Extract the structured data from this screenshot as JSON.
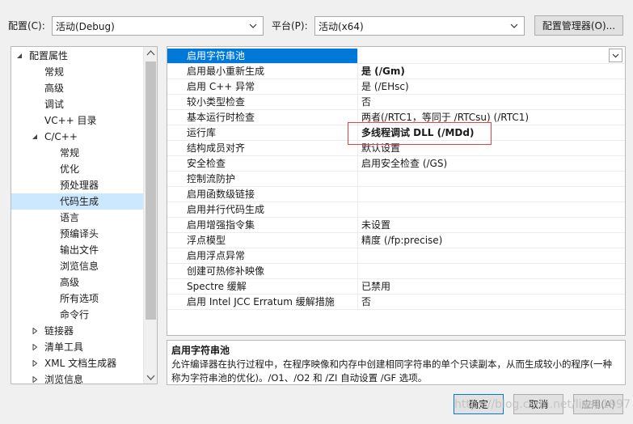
{
  "top_bar": {
    "config_label": "配置(C):",
    "config_value": "活动(Debug)",
    "platform_label": "平台(P):",
    "platform_value": "活动(x64)",
    "config_manager_button": "配置管理器(O)..."
  },
  "tree": {
    "items": [
      {
        "label": "配置属性",
        "expanded": true
      },
      {
        "label": "常规"
      },
      {
        "label": "高级"
      },
      {
        "label": "调试"
      },
      {
        "label": "VC++ 目录"
      },
      {
        "label": "C/C++",
        "expanded": true
      },
      {
        "label": "常规"
      },
      {
        "label": "优化"
      },
      {
        "label": "预处理器"
      },
      {
        "label": "代码生成",
        "selected": true
      },
      {
        "label": "语言"
      },
      {
        "label": "预编译头"
      },
      {
        "label": "输出文件"
      },
      {
        "label": "浏览信息"
      },
      {
        "label": "高级"
      },
      {
        "label": "所有选项"
      },
      {
        "label": "命令行"
      },
      {
        "label": "链接器",
        "expanded": false
      },
      {
        "label": "清单工具",
        "expanded": false
      },
      {
        "label": "XML 文档生成器",
        "expanded": false
      },
      {
        "label": "浏览信息",
        "expanded": false
      }
    ]
  },
  "properties": [
    {
      "name": "启用字符串池",
      "value": "",
      "selected": true
    },
    {
      "name": "启用最小重新生成",
      "value": "是 (/Gm)",
      "bold": true
    },
    {
      "name": "启用 C++ 异常",
      "value": "是 (/EHsc)"
    },
    {
      "name": "较小类型检查",
      "value": "否"
    },
    {
      "name": "基本运行时检查",
      "value": "两者(/RTC1，等同于 /RTCsu) (/RTC1)"
    },
    {
      "name": "运行库",
      "value": "多线程调试 DLL (/MDd)",
      "bold": true
    },
    {
      "name": "结构成员对齐",
      "value": "默认设置"
    },
    {
      "name": "安全检查",
      "value": "启用安全检查 (/GS)"
    },
    {
      "name": "控制流防护",
      "value": ""
    },
    {
      "name": "启用函数级链接",
      "value": ""
    },
    {
      "name": "启用并行代码生成",
      "value": ""
    },
    {
      "name": "启用增强指令集",
      "value": "未设置"
    },
    {
      "name": "浮点模型",
      "value": "精度 (/fp:precise)"
    },
    {
      "name": "启用浮点异常",
      "value": ""
    },
    {
      "name": "创建可热修补映像",
      "value": ""
    },
    {
      "name": "Spectre 缓解",
      "value": "已禁用"
    },
    {
      "name": "启用 Intel JCC Erratum 缓解措施",
      "value": "否"
    }
  ],
  "description": {
    "title": "启用字符串池",
    "text": "允许编译器在执行过程中，在程序映像和内存中创建相同字符串的单个只读副本，从而生成较小的程序(一种称为字符串池的优化)。/O1、/O2 和 /ZI 自动设置 /GF 选项。"
  },
  "buttons": {
    "ok": "确定",
    "cancel": "取消",
    "apply": "应用(A)"
  },
  "watermark": "https://blog.csdn.net/lias11997",
  "colors": {
    "selection": "#0078d7",
    "tree_selection": "#cce8ff",
    "highlight_box": "#e0463f"
  }
}
